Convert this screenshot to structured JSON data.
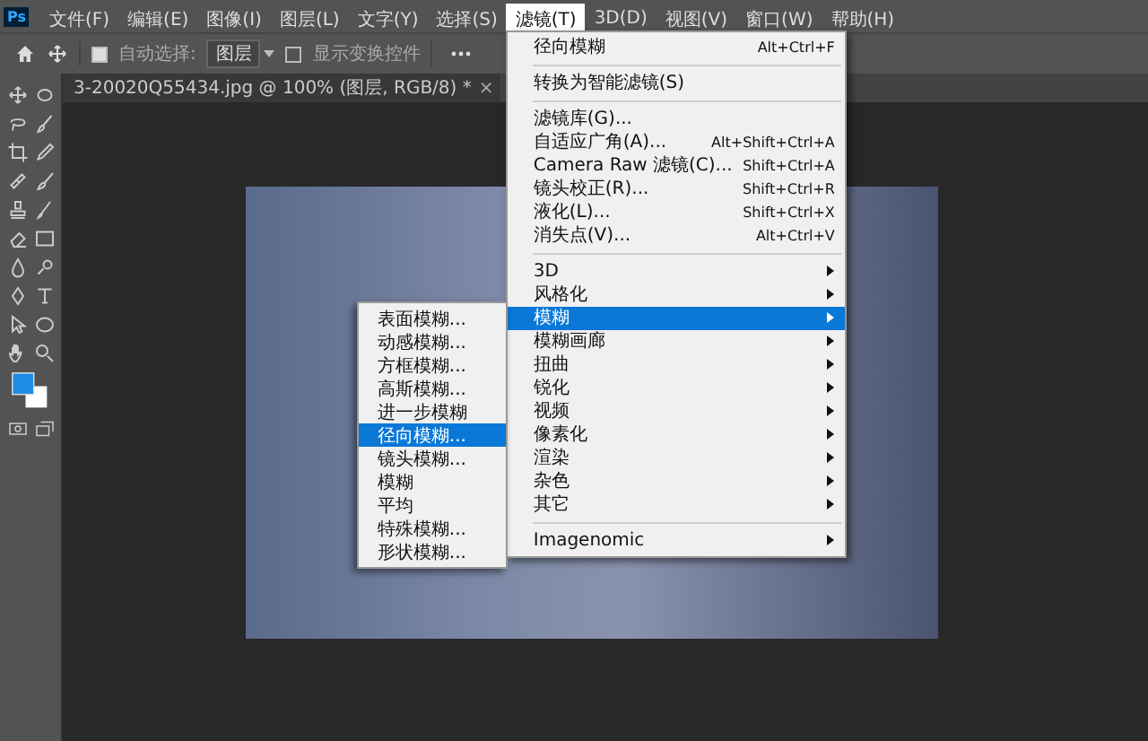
{
  "app": {
    "logo": "Ps"
  },
  "menubar": [
    {
      "label": "文件(F)",
      "selected": false
    },
    {
      "label": "编辑(E)",
      "selected": false
    },
    {
      "label": "图像(I)",
      "selected": false
    },
    {
      "label": "图层(L)",
      "selected": false
    },
    {
      "label": "文字(Y)",
      "selected": false
    },
    {
      "label": "选择(S)",
      "selected": false
    },
    {
      "label": "滤镜(T)",
      "selected": true
    },
    {
      "label": "3D(D)",
      "selected": false
    },
    {
      "label": "视图(V)",
      "selected": false
    },
    {
      "label": "窗口(W)",
      "selected": false
    },
    {
      "label": "帮助(H)",
      "selected": false
    }
  ],
  "options_bar": {
    "auto_select_label": "自动选择:",
    "auto_select_checked": true,
    "layer_dropdown": "图层",
    "show_transform_label": "显示变换控件",
    "show_transform_checked": false
  },
  "document_tab": {
    "title": "3-20020Q55434.jpg @ 100% (图层, RGB/8) *",
    "close": "×"
  },
  "filter_menu": [
    {
      "kind": "item",
      "label": "径向模糊",
      "shortcut": "Alt+Ctrl+F",
      "selected": false
    },
    {
      "kind": "separator"
    },
    {
      "kind": "item",
      "label": "转换为智能滤镜(S)",
      "selected": false
    },
    {
      "kind": "separator"
    },
    {
      "kind": "item",
      "label": "滤镜库(G)...",
      "selected": false
    },
    {
      "kind": "item",
      "label": "自适应广角(A)...",
      "shortcut": "Alt+Shift+Ctrl+A",
      "selected": false
    },
    {
      "kind": "item",
      "label": "Camera Raw 滤镜(C)...",
      "shortcut": "Shift+Ctrl+A",
      "selected": false
    },
    {
      "kind": "item",
      "label": "镜头校正(R)...",
      "shortcut": "Shift+Ctrl+R",
      "selected": false
    },
    {
      "kind": "item",
      "label": "液化(L)...",
      "shortcut": "Shift+Ctrl+X",
      "selected": false
    },
    {
      "kind": "item",
      "label": "消失点(V)...",
      "shortcut": "Alt+Ctrl+V",
      "selected": false
    },
    {
      "kind": "separator"
    },
    {
      "kind": "submenu",
      "label": "3D",
      "selected": false
    },
    {
      "kind": "submenu",
      "label": "风格化",
      "selected": false
    },
    {
      "kind": "submenu",
      "label": "模糊",
      "selected": true
    },
    {
      "kind": "submenu",
      "label": "模糊画廊",
      "selected": false
    },
    {
      "kind": "submenu",
      "label": "扭曲",
      "selected": false
    },
    {
      "kind": "submenu",
      "label": "锐化",
      "selected": false
    },
    {
      "kind": "submenu",
      "label": "视频",
      "selected": false
    },
    {
      "kind": "submenu",
      "label": "像素化",
      "selected": false
    },
    {
      "kind": "submenu",
      "label": "渲染",
      "selected": false
    },
    {
      "kind": "submenu",
      "label": "杂色",
      "selected": false
    },
    {
      "kind": "submenu",
      "label": "其它",
      "selected": false
    },
    {
      "kind": "separator"
    },
    {
      "kind": "submenu",
      "label": "Imagenomic",
      "selected": false
    }
  ],
  "blur_submenu": [
    {
      "label": "表面模糊...",
      "selected": false
    },
    {
      "label": "动感模糊...",
      "selected": false
    },
    {
      "label": "方框模糊...",
      "selected": false
    },
    {
      "label": "高斯模糊...",
      "selected": false
    },
    {
      "label": "进一步模糊",
      "selected": false
    },
    {
      "label": "径向模糊...",
      "selected": true
    },
    {
      "label": "镜头模糊...",
      "selected": false
    },
    {
      "label": "模糊",
      "selected": false
    },
    {
      "label": "平均",
      "selected": false
    },
    {
      "label": "特殊模糊...",
      "selected": false
    },
    {
      "label": "形状模糊...",
      "selected": false
    }
  ]
}
